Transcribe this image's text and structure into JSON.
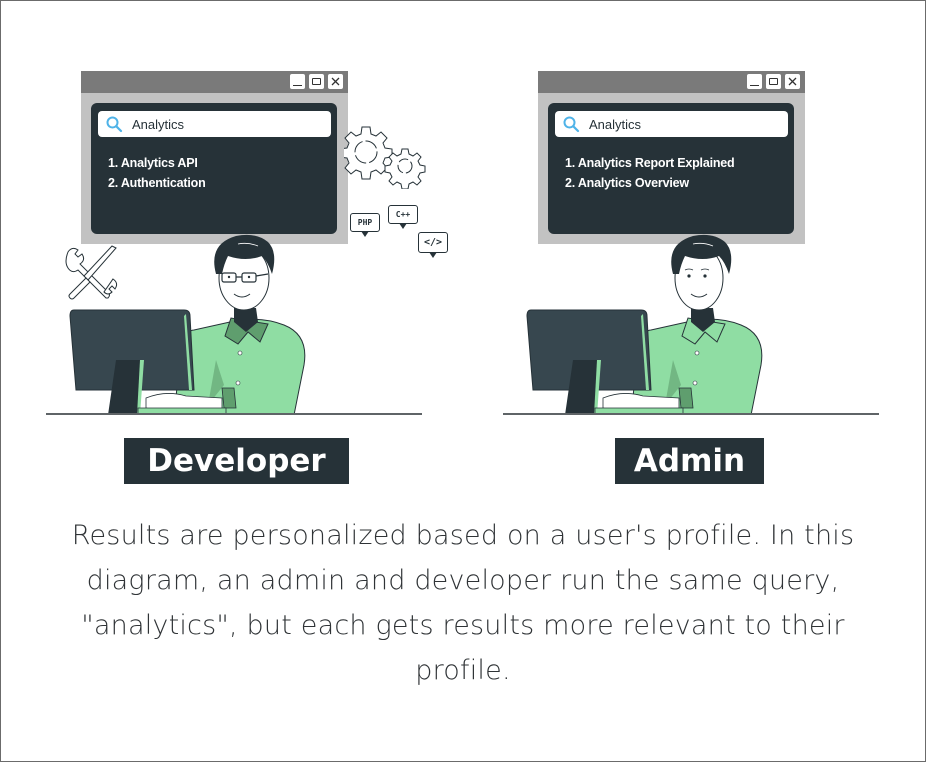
{
  "personas": [
    {
      "id": "developer",
      "label": "Developer",
      "search_query": "Analytics",
      "results": [
        "1. Analytics API",
        "2. Authentication"
      ],
      "has_glasses": true,
      "decorations": {
        "speech_bubbles": [
          "PHP",
          "C++",
          "</>"
        ],
        "icons": [
          "gears-icon",
          "wrench-screwdriver-icon"
        ]
      }
    },
    {
      "id": "admin",
      "label": "Admin",
      "search_query": "Analytics",
      "results": [
        "1. Analytics Report Explained",
        "2. Analytics Overview"
      ],
      "has_glasses": false
    }
  ],
  "caption": "Results are personalized based on a user's profile. In this diagram, an admin and developer run the same query, \"analytics\", but each gets results more relevant to their profile.",
  "colors": {
    "dark": "#263238",
    "shirt": "#8fdda3",
    "shirt_shade": "#5f9e6e",
    "search_icon": "#4fb3e8",
    "window_frame": "#c2c2c2",
    "titlebar": "#7a7a7a"
  }
}
